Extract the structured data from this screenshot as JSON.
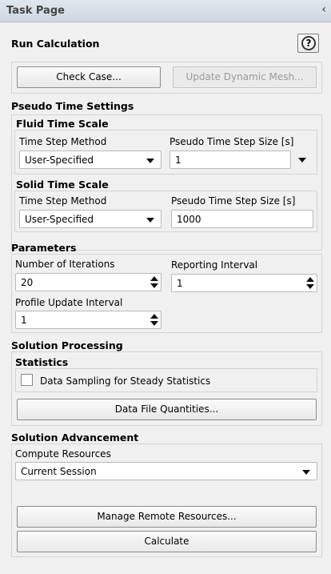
{
  "panel": {
    "title": "Task Page",
    "collapse_icon": "chevron-left-icon"
  },
  "run": {
    "title": "Run Calculation",
    "help_label": "?",
    "check_case": "Check Case...",
    "update_mesh": "Update Dynamic Mesh..."
  },
  "pseudo": {
    "title": "Pseudo Time Settings",
    "fluid": {
      "title": "Fluid Time Scale",
      "method_label": "Time Step Method",
      "method_value": "User-Specified",
      "size_label": "Pseudo Time Step Size [s]",
      "size_value": "1"
    },
    "solid": {
      "title": "Solid Time Scale",
      "method_label": "Time Step Method",
      "method_value": "User-Specified",
      "size_label": "Pseudo Time Step Size [s]",
      "size_value": "1000"
    }
  },
  "parameters": {
    "title": "Parameters",
    "iterations_label": "Number of Iterations",
    "iterations_value": "20",
    "reporting_label": "Reporting Interval",
    "reporting_value": "1",
    "profile_label": "Profile Update Interval",
    "profile_value": "1"
  },
  "processing": {
    "title": "Solution Processing",
    "statistics_title": "Statistics",
    "sampling_label": "Data Sampling for Steady Statistics",
    "sampling_checked": false,
    "data_file_button": "Data File Quantities..."
  },
  "advancement": {
    "title": "Solution Advancement",
    "compute_label": "Compute Resources",
    "compute_value": "Current Session",
    "manage_button": "Manage Remote Resources...",
    "calculate_button": "Calculate"
  }
}
